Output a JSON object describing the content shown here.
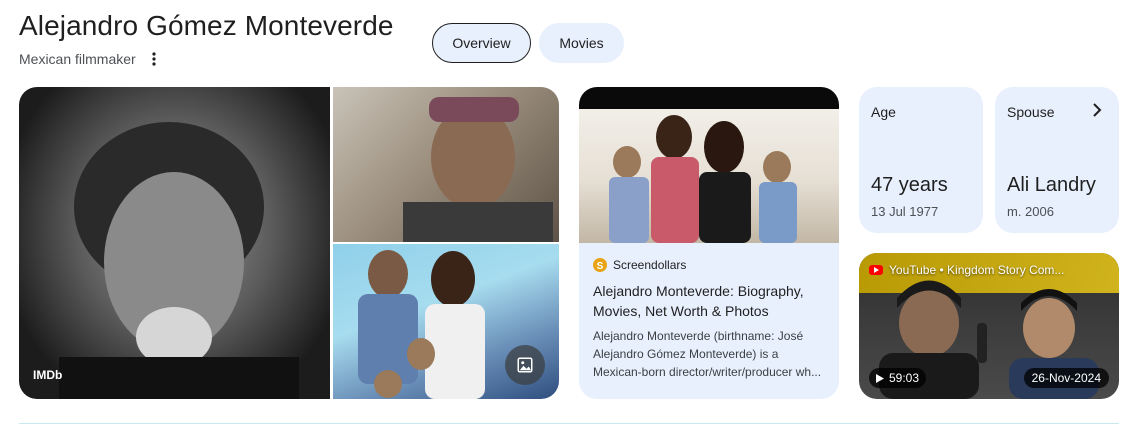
{
  "header": {
    "title": "Alejandro Gómez Monteverde",
    "subtitle": "Mexican filmmaker"
  },
  "tabs": [
    {
      "label": "Overview",
      "selected": true
    },
    {
      "label": "Movies",
      "selected": false
    }
  ],
  "images": {
    "main_source": "IMDb"
  },
  "article": {
    "source": "Screendollars",
    "title": "Alejandro Monteverde: Biography, Movies, Net Worth & Photos",
    "snippet": "Alejandro Monteverde (birthname: José Alejandro Gómez Monteverde) is a Mexican-born director/writer/producer wh..."
  },
  "facts": {
    "age": {
      "label": "Age",
      "value": "47 years",
      "detail": "13 Jul 1977"
    },
    "spouse": {
      "label": "Spouse",
      "value": "Ali Landry",
      "detail": "m. 2006"
    }
  },
  "video": {
    "source": "YouTube • Kingdom Story Com...",
    "duration": "59:03",
    "date": "26-Nov-2024"
  },
  "colors": {
    "chip_bg": "#e8f0fe",
    "text": "#1f1f1f",
    "muted": "#4d5156"
  }
}
